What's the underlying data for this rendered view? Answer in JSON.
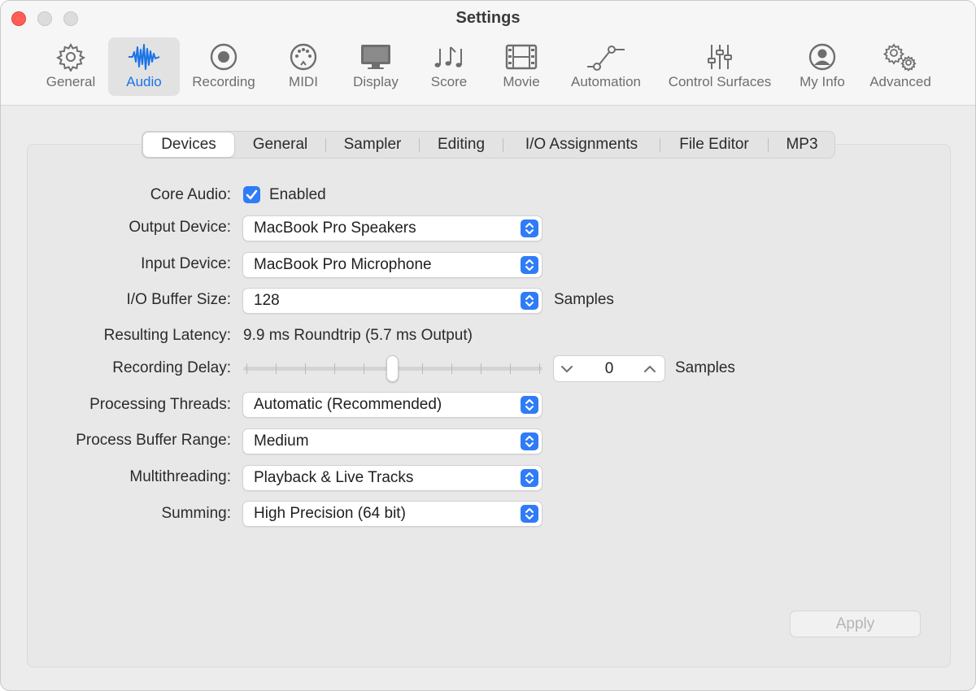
{
  "window": {
    "title": "Settings"
  },
  "toolbar": {
    "items": [
      {
        "label": "General",
        "icon": "gear-icon"
      },
      {
        "label": "Audio",
        "icon": "waveform-icon",
        "active": true
      },
      {
        "label": "Recording",
        "icon": "record-icon"
      },
      {
        "label": "MIDI",
        "icon": "midi-icon"
      },
      {
        "label": "Display",
        "icon": "display-icon"
      },
      {
        "label": "Score",
        "icon": "music-notes-icon"
      },
      {
        "label": "Movie",
        "icon": "film-icon"
      },
      {
        "label": "Automation",
        "icon": "automation-icon"
      },
      {
        "label": "Control Surfaces",
        "icon": "sliders-icon"
      },
      {
        "label": "My Info",
        "icon": "person-icon"
      },
      {
        "label": "Advanced",
        "icon": "gears-icon"
      }
    ]
  },
  "tabs": [
    {
      "label": "Devices",
      "active": true
    },
    {
      "label": "General"
    },
    {
      "label": "Sampler"
    },
    {
      "label": "Editing"
    },
    {
      "label": "I/O Assignments"
    },
    {
      "label": "File Editor"
    },
    {
      "label": "MP3"
    }
  ],
  "form": {
    "core_audio": {
      "label": "Core Audio:",
      "checkbox_label": "Enabled",
      "checked": true
    },
    "output_device": {
      "label": "Output Device:",
      "value": "MacBook Pro Speakers"
    },
    "input_device": {
      "label": "Input Device:",
      "value": "MacBook Pro Microphone"
    },
    "io_buffer": {
      "label": "I/O Buffer Size:",
      "value": "128",
      "unit": "Samples"
    },
    "latency": {
      "label": "Resulting Latency:",
      "value": "9.9 ms Roundtrip (5.7 ms Output)"
    },
    "recording_delay": {
      "label": "Recording Delay:",
      "value": "0",
      "unit": "Samples",
      "slider_position": 0.5
    },
    "processing_threads": {
      "label": "Processing Threads:",
      "value": "Automatic (Recommended)"
    },
    "process_buffer_range": {
      "label": "Process Buffer Range:",
      "value": "Medium"
    },
    "multithreading": {
      "label": "Multithreading:",
      "value": "Playback & Live Tracks"
    },
    "summing": {
      "label": "Summing:",
      "value": "High Precision (64 bit)"
    }
  },
  "apply_label": "Apply",
  "colors": {
    "accent": "#2f7cf6",
    "active_label": "#1a73e8",
    "close": "#ff5f57"
  }
}
